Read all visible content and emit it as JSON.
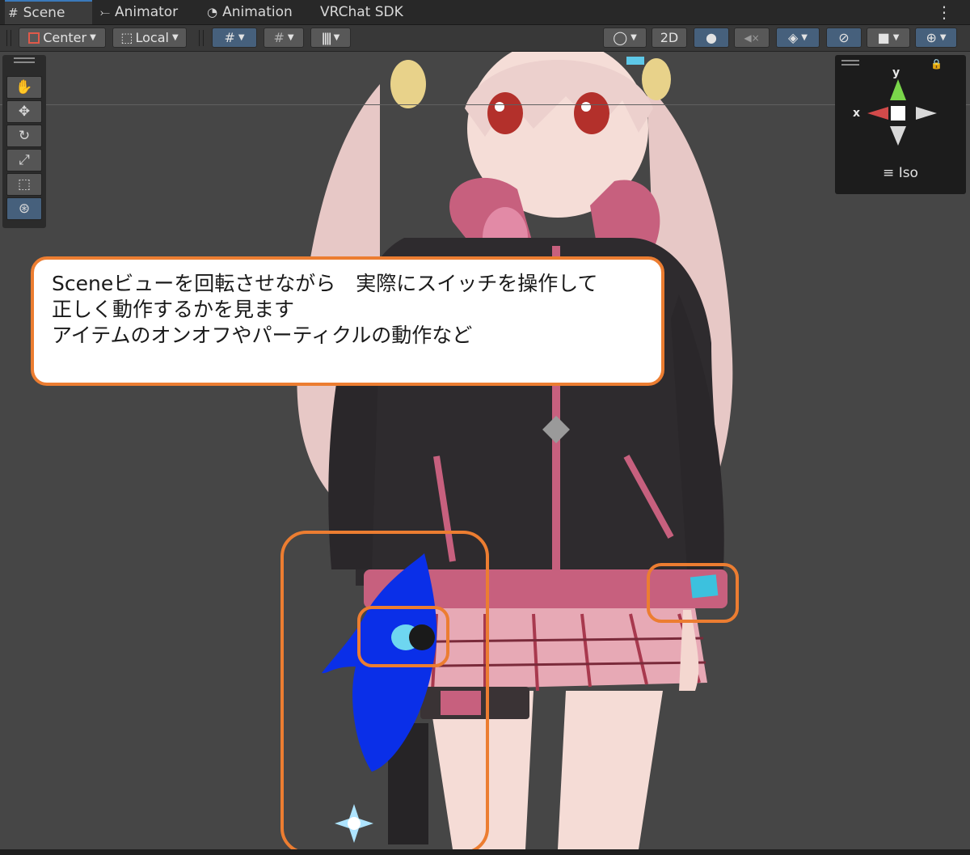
{
  "tabs": [
    {
      "icon": "#",
      "label": "Scene"
    },
    {
      "icon": "⤚",
      "label": "Animator"
    },
    {
      "icon": "◔",
      "label": "Animation"
    },
    {
      "icon": "",
      "label": "VRChat SDK"
    }
  ],
  "toolbar": {
    "pivot_label": "Center",
    "space_label": "Local",
    "mode_2d_label": "2D"
  },
  "gizmo": {
    "y_label": "y",
    "x_label": "x",
    "projection_label": "Iso"
  },
  "callout": {
    "line1": "Sceneビューを回転させながら　実際にスイッチを操作して",
    "line2": "正しく動作するかを見ます",
    "line3": "",
    "line4": "アイテムのオンオフやパーティクルの動作など"
  },
  "colors": {
    "highlight": "#ec7d31",
    "active_button": "#46607c",
    "tab_accent": "#3a79bb",
    "shark": "#0a2fe8",
    "hoodie": "#2e2b2e",
    "pink_trim": "#c7607e"
  }
}
